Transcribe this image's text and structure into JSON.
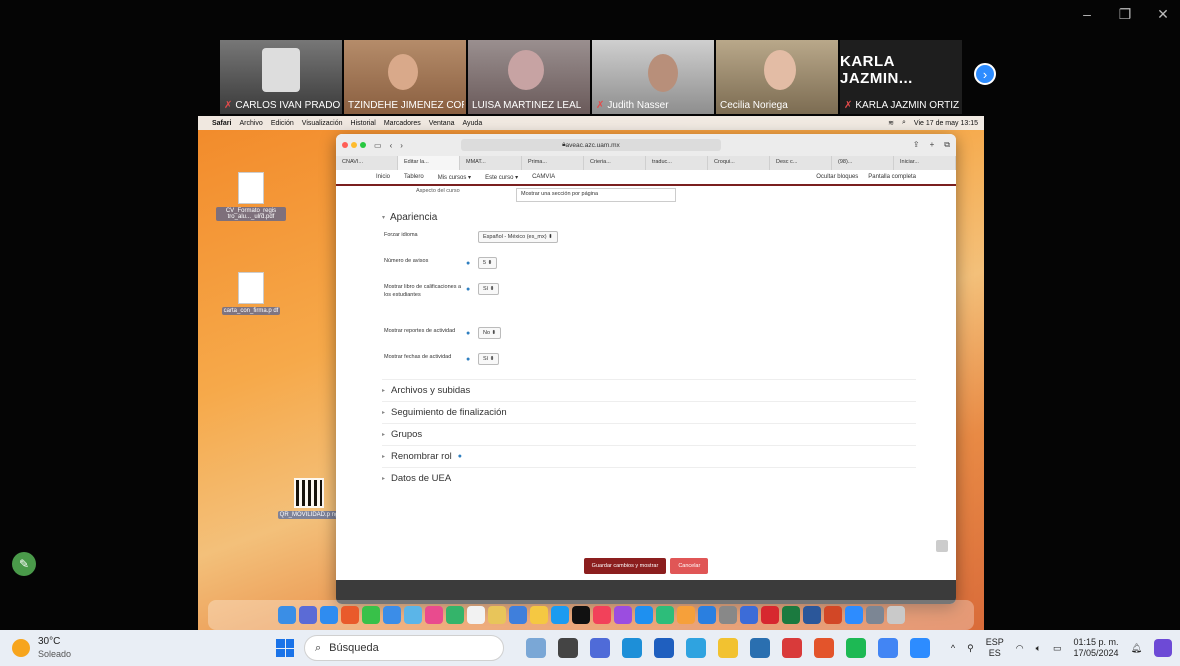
{
  "window_controls": {
    "minimize": "–",
    "restore": "❐",
    "close": "✕"
  },
  "participants": [
    {
      "name": "CARLOS IVAN PRADO ...",
      "muted": true,
      "active": false
    },
    {
      "name": "TZINDEHE JIMENEZ CORR...",
      "muted": false,
      "active": true
    },
    {
      "name": "LUISA MARTINEZ LEAL",
      "muted": false,
      "active": false
    },
    {
      "name": "Judith Nasser",
      "muted": true,
      "active": false
    },
    {
      "name": "Cecilia Noriega",
      "muted": false,
      "active": false
    },
    {
      "name": "KARLA JAZMIN ORTIZ ...",
      "muted": true,
      "active": false,
      "display_name": "KARLA JAZMIN..."
    }
  ],
  "mac_menubar": {
    "items": [
      "Safari",
      "Archivo",
      "Edición",
      "Visualización",
      "Historial",
      "Marcadores",
      "Ventana",
      "Ayuda"
    ],
    "clock": "Vie 17 de may 13:15"
  },
  "desktop_icons": [
    {
      "label": "CV_Formato_regis tro_alu..._ulrd.pdf"
    },
    {
      "label": "carta_con_firma.p df"
    },
    {
      "label": "QR_MOVILIDAD.p ng"
    }
  ],
  "safari": {
    "url": "aveac.azc.uam.mx",
    "tabs": [
      "CNAVI...",
      "Editar la...",
      "MMAT...",
      "Prima...",
      "Crieria...",
      "traduc...",
      "Croqui...",
      "Desc c...",
      "(98)...",
      "Iniciar..."
    ],
    "nav": {
      "items": [
        "Inicio",
        "Tablero",
        "Mis cursos ▾",
        "Este curso ▾",
        "CAMVIA"
      ],
      "right": [
        "Ocultar bloques",
        "Pantalla completa"
      ]
    }
  },
  "form": {
    "top_select_label": "Aspecto del curso",
    "top_select_value": "Mostrar una sección por página",
    "section_title": "Apariencia",
    "fields": [
      {
        "label": "Forzar idioma",
        "value": "Español - México (es_mx) ⬍",
        "has_info": false
      },
      {
        "label": "Número de avisos",
        "value": "5 ⬍",
        "has_info": true
      },
      {
        "label": "Mostrar libro de calificaciones a los estudiantes",
        "value": "Sí ⬍",
        "has_info": true
      },
      {
        "label": "Mostrar reportes de actividad",
        "value": "No ⬍",
        "has_info": true
      },
      {
        "label": "Mostrar fechas de actividad",
        "value": "Sí ⬍",
        "has_info": true
      }
    ],
    "collapsed_sections": [
      {
        "label": "Archivos y subidas",
        "has_info": false
      },
      {
        "label": "Seguimiento de finalización",
        "has_info": false
      },
      {
        "label": "Grupos",
        "has_info": false
      },
      {
        "label": "Renombrar rol",
        "has_info": true
      },
      {
        "label": "Datos de UEA",
        "has_info": false
      }
    ],
    "save_label": "Guardar cambios y mostrar",
    "cancel_label": "Cancelar"
  },
  "taskbar": {
    "weather_temp": "30°C",
    "weather_desc": "Soleado",
    "search_placeholder": "Búsqueda",
    "lang_top": "ESP",
    "lang_bottom": "ES",
    "time": "01:15 p. m.",
    "date": "17/05/2024"
  }
}
